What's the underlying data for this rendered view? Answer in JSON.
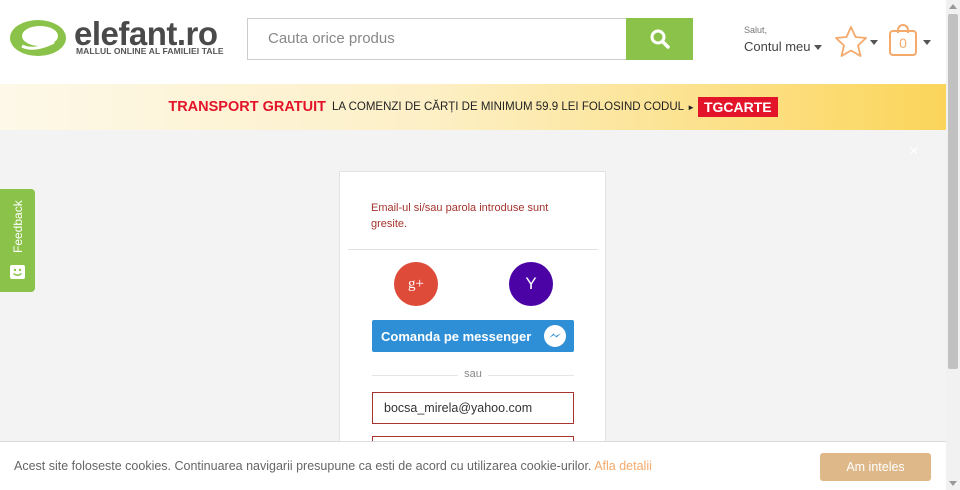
{
  "colors": {
    "brand_green": "#8bc34a",
    "promo_red": "#e3142a",
    "error_red": "#a5342e",
    "messenger_blue": "#2f8fd6",
    "google_red": "#de4b39",
    "yahoo_purple": "#4b03a6",
    "cart_orange": "#f5a96b",
    "cookie_button": "#deb888"
  },
  "header": {
    "logo_text": "elefant.ro",
    "logo_tagline": "MALLUL ONLINE AL FAMILIEI TALE",
    "search_placeholder": "Cauta orice produs",
    "greeting": "Salut,",
    "account_label": "Contul meu",
    "cart_count": "0",
    "icons": [
      "search-icon",
      "star-icon",
      "cart-icon",
      "chevron-down-icon"
    ]
  },
  "banner": {
    "highlight": "TRANSPORT GRATUIT",
    "text": "LA COMENZI DE CĂRȚI DE MINIMUM 59.9 LEI FOLOSIND CODUL",
    "arrow": "►",
    "code": "TGCARTE"
  },
  "overlay": {
    "close": "×"
  },
  "feedback": {
    "label": "Feedback"
  },
  "login": {
    "error": "Email-ul si/sau parola introduse sunt gresite.",
    "google_label": "g+",
    "yahoo_label": "Y",
    "messenger_label": "Comanda pe messenger",
    "divider": "sau",
    "email_value": "bocsa_mirela@yahoo.com"
  },
  "cookie": {
    "text": "Acest site foloseste cookies. Continuarea navigarii presupune ca esti de acord cu utilizarea cookie-urilor.",
    "link": "Afla detalii",
    "button": "Am inteles"
  }
}
